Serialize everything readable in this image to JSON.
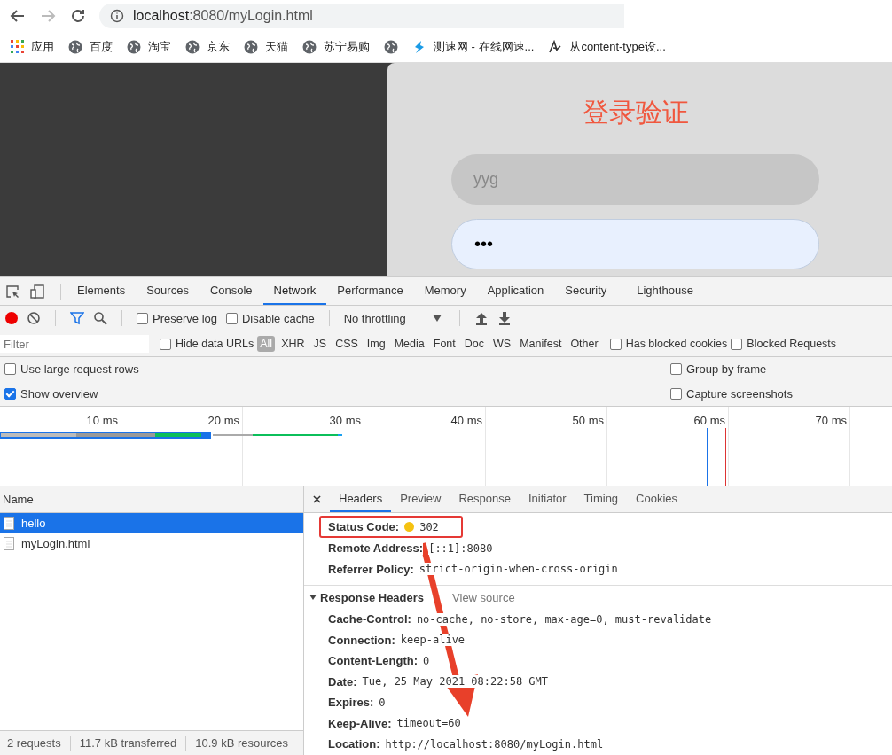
{
  "browser": {
    "url_host": "localhost",
    "url_rest": ":8080/myLogin.html",
    "bookmarks": [
      {
        "label": "应用",
        "kind": "apps"
      },
      {
        "label": "百度",
        "kind": "globe"
      },
      {
        "label": "淘宝",
        "kind": "globe"
      },
      {
        "label": "京东",
        "kind": "globe"
      },
      {
        "label": "天猫",
        "kind": "globe"
      },
      {
        "label": "苏宁易购",
        "kind": "globe"
      },
      {
        "kind": "globe"
      },
      {
        "label": "测速网 - 在线网速...",
        "kind": "speed"
      },
      {
        "label": "从content-type设...",
        "kind": "script"
      }
    ]
  },
  "page": {
    "title": "登录验证",
    "username": "yyg",
    "password": "•••"
  },
  "devtools": {
    "tabs": [
      {
        "label": "Elements",
        "selected": false
      },
      {
        "label": "Sources",
        "selected": false
      },
      {
        "label": "Console",
        "selected": false
      },
      {
        "label": "Network",
        "selected": true
      },
      {
        "label": "Performance",
        "selected": false
      },
      {
        "label": "Memory",
        "selected": false
      },
      {
        "label": "Application",
        "selected": false
      },
      {
        "label": "Security",
        "selected": false
      },
      {
        "label": "Lighthouse",
        "selected": false
      }
    ],
    "recording": true,
    "preserve_log": {
      "label": "Preserve log",
      "checked": false
    },
    "disable_cache": {
      "label": "Disable cache",
      "checked": false
    },
    "throttling": "No throttling",
    "filter": {
      "placeholder": "Filter"
    },
    "hide_data_urls": {
      "label": "Hide data URLs",
      "checked": false
    },
    "types": [
      {
        "label": "All",
        "selected": true
      },
      {
        "label": "XHR",
        "selected": false
      },
      {
        "label": "JS",
        "selected": false
      },
      {
        "label": "CSS",
        "selected": false
      },
      {
        "label": "Img",
        "selected": false
      },
      {
        "label": "Media",
        "selected": false
      },
      {
        "label": "Font",
        "selected": false
      },
      {
        "label": "Doc",
        "selected": false
      },
      {
        "label": "WS",
        "selected": false
      },
      {
        "label": "Manifest",
        "selected": false
      },
      {
        "label": "Other",
        "selected": false
      }
    ],
    "blocked_cookies": {
      "label": "Has blocked cookies",
      "checked": false
    },
    "blocked_requests": {
      "label": "Blocked Requests",
      "checked": false
    },
    "options": [
      {
        "label": "Use large request rows",
        "checked": false
      },
      {
        "label": "Group by frame",
        "checked": false
      },
      {
        "label": "Show overview",
        "checked": true
      },
      {
        "label": "Capture screenshots",
        "checked": false
      }
    ],
    "timeline": {
      "ticks": [
        "10 ms",
        "20 ms",
        "30 ms",
        "40 ms",
        "50 ms",
        "60 ms",
        "70 ms"
      ]
    },
    "requests": {
      "column": "Name",
      "rows": [
        {
          "name": "hello",
          "selected": true
        },
        {
          "name": "myLogin.html",
          "selected": false
        }
      ]
    },
    "detail_tabs": [
      {
        "label": "Headers",
        "selected": true
      },
      {
        "label": "Preview",
        "selected": false
      },
      {
        "label": "Response",
        "selected": false
      },
      {
        "label": "Initiator",
        "selected": false
      },
      {
        "label": "Timing",
        "selected": false
      },
      {
        "label": "Cookies",
        "selected": false
      }
    ],
    "general": [
      {
        "key": "Status Code:",
        "value": "302",
        "color": "#f5c211"
      },
      {
        "key": "Remote Address:",
        "value": "[::1]:8080"
      },
      {
        "key": "Referrer Policy:",
        "value": "strict-origin-when-cross-origin"
      }
    ],
    "response_headers": {
      "title": "Response Headers",
      "view_source": "View source",
      "expanded": true,
      "items": [
        {
          "key": "Cache-Control:",
          "value": "no-cache, no-store, max-age=0, must-revalidate"
        },
        {
          "key": "Connection:",
          "value": "keep-alive"
        },
        {
          "key": "Content-Length:",
          "value": "0"
        },
        {
          "key": "Date:",
          "value": "Tue, 25 May 2021 08:22:58 GMT"
        },
        {
          "key": "Expires:",
          "value": "0"
        },
        {
          "key": "Keep-Alive:",
          "value": "timeout=60"
        },
        {
          "key": "Location:",
          "value": "http://localhost:8080/myLogin.html"
        }
      ]
    },
    "status_bar": [
      "2 requests",
      "11.7 kB transferred",
      "10.9 kB resources"
    ]
  }
}
